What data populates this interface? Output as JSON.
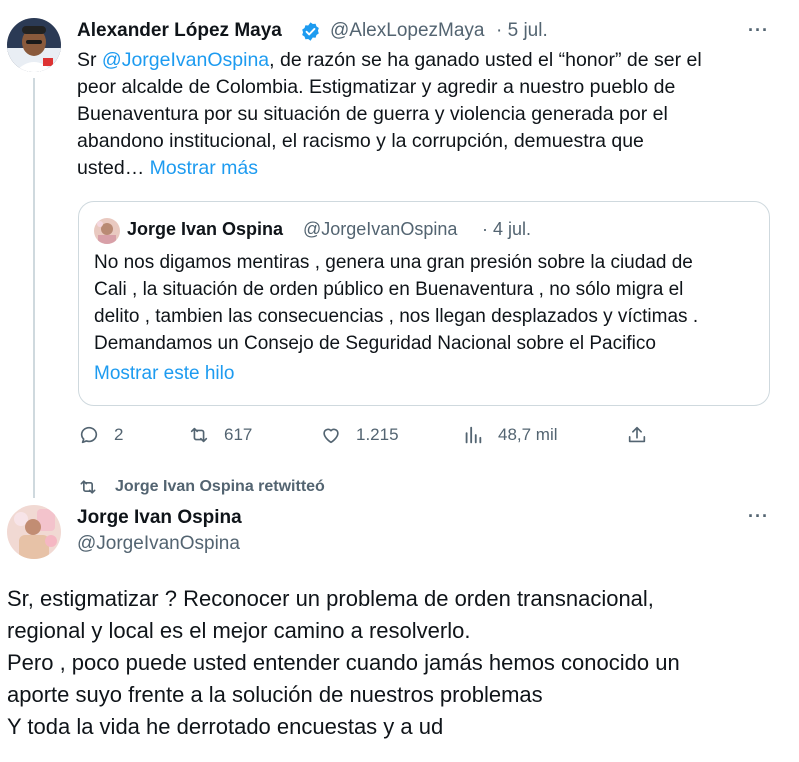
{
  "tweet1": {
    "author_name": "Alexander López Maya",
    "handle": "@AlexLopezMaya",
    "date": "· 5 jul.",
    "more": "···",
    "text_prefix": "Sr ",
    "mention": "@JorgeIvanOspina",
    "text_line1_rest": ", de razón se ha ganado usted el “honor” de ser el",
    "text_line2": "peor alcalde de Colombia. Estigmatizar y agredir a nuestro pueblo de",
    "text_line3": "Buenaventura por su situación de guerra y violencia generada por el",
    "text_line4": "abandono institucional, el racismo y la corrupción, demuestra que",
    "text_line5": "usted… ",
    "show_more": "Mostrar más",
    "verified_color": "#1d9bf0"
  },
  "quote": {
    "author_name": "Jorge Ivan Ospina",
    "handle": "@JorgeIvanOspina",
    "date": "· 4 jul.",
    "line1": "No nos digamos mentiras , genera una gran presión sobre la ciudad de",
    "line2": "Cali , la situación de orden público en Buenaventura , no sólo migra el",
    "line3": "delito , tambien las consecuencias , nos llegan desplazados y víctimas .",
    "line4": "Demandamos un Consejo de Seguridad Nacional sobre el Pacifico",
    "show_thread": "Mostrar este hilo"
  },
  "actions": {
    "replies": "2",
    "retweets": "617",
    "likes": "1.215",
    "views": "48,7 mil"
  },
  "retweet_banner": {
    "label": "Jorge Ivan Ospina retwitteó"
  },
  "tweet2": {
    "author_name": "Jorge Ivan Ospina",
    "handle": "@JorgeIvanOspina",
    "more": "···",
    "line1": "Sr, estigmatizar ? Reconocer un problema de orden transnacional,",
    "line2": "regional y local es el mejor camino a resolverlo.",
    "line3": "Pero , poco puede usted entender cuando jamás hemos conocido un",
    "line4": "aporte suyo frente a la solución de nuestros problemas",
    "line5": "Y toda la vida he derrotado encuestas y a ud"
  },
  "colors": {
    "link": "#1d9bf0",
    "secondary": "#536471",
    "border": "#cfd9de"
  }
}
